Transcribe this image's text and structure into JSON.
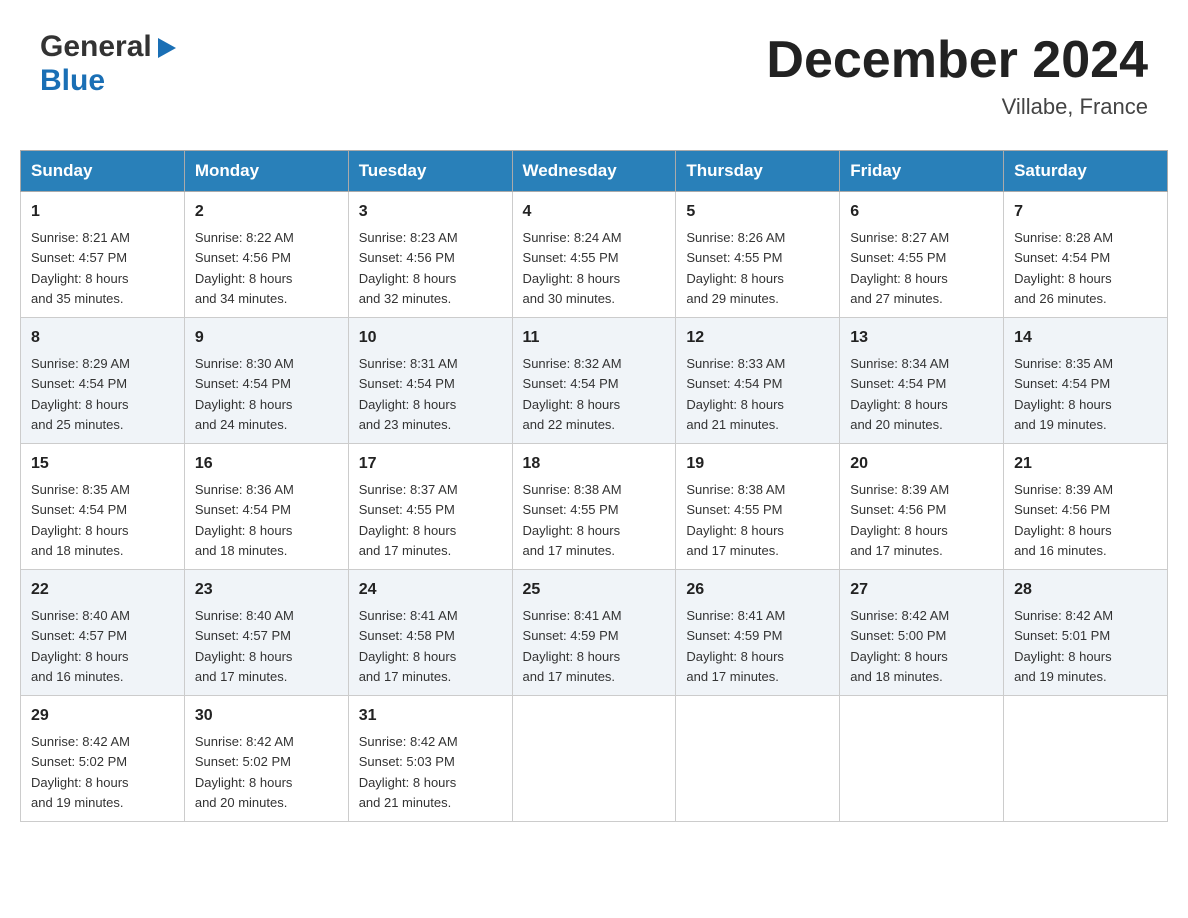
{
  "header": {
    "logo_line1": "General",
    "logo_line2": "Blue",
    "month_title": "December 2024",
    "location": "Villabe, France"
  },
  "calendar": {
    "days_of_week": [
      "Sunday",
      "Monday",
      "Tuesday",
      "Wednesday",
      "Thursday",
      "Friday",
      "Saturday"
    ],
    "weeks": [
      [
        {
          "day": "1",
          "sunrise": "Sunrise: 8:21 AM",
          "sunset": "Sunset: 4:57 PM",
          "daylight": "Daylight: 8 hours",
          "daylight2": "and 35 minutes."
        },
        {
          "day": "2",
          "sunrise": "Sunrise: 8:22 AM",
          "sunset": "Sunset: 4:56 PM",
          "daylight": "Daylight: 8 hours",
          "daylight2": "and 34 minutes."
        },
        {
          "day": "3",
          "sunrise": "Sunrise: 8:23 AM",
          "sunset": "Sunset: 4:56 PM",
          "daylight": "Daylight: 8 hours",
          "daylight2": "and 32 minutes."
        },
        {
          "day": "4",
          "sunrise": "Sunrise: 8:24 AM",
          "sunset": "Sunset: 4:55 PM",
          "daylight": "Daylight: 8 hours",
          "daylight2": "and 30 minutes."
        },
        {
          "day": "5",
          "sunrise": "Sunrise: 8:26 AM",
          "sunset": "Sunset: 4:55 PM",
          "daylight": "Daylight: 8 hours",
          "daylight2": "and 29 minutes."
        },
        {
          "day": "6",
          "sunrise": "Sunrise: 8:27 AM",
          "sunset": "Sunset: 4:55 PM",
          "daylight": "Daylight: 8 hours",
          "daylight2": "and 27 minutes."
        },
        {
          "day": "7",
          "sunrise": "Sunrise: 8:28 AM",
          "sunset": "Sunset: 4:54 PM",
          "daylight": "Daylight: 8 hours",
          "daylight2": "and 26 minutes."
        }
      ],
      [
        {
          "day": "8",
          "sunrise": "Sunrise: 8:29 AM",
          "sunset": "Sunset: 4:54 PM",
          "daylight": "Daylight: 8 hours",
          "daylight2": "and 25 minutes."
        },
        {
          "day": "9",
          "sunrise": "Sunrise: 8:30 AM",
          "sunset": "Sunset: 4:54 PM",
          "daylight": "Daylight: 8 hours",
          "daylight2": "and 24 minutes."
        },
        {
          "day": "10",
          "sunrise": "Sunrise: 8:31 AM",
          "sunset": "Sunset: 4:54 PM",
          "daylight": "Daylight: 8 hours",
          "daylight2": "and 23 minutes."
        },
        {
          "day": "11",
          "sunrise": "Sunrise: 8:32 AM",
          "sunset": "Sunset: 4:54 PM",
          "daylight": "Daylight: 8 hours",
          "daylight2": "and 22 minutes."
        },
        {
          "day": "12",
          "sunrise": "Sunrise: 8:33 AM",
          "sunset": "Sunset: 4:54 PM",
          "daylight": "Daylight: 8 hours",
          "daylight2": "and 21 minutes."
        },
        {
          "day": "13",
          "sunrise": "Sunrise: 8:34 AM",
          "sunset": "Sunset: 4:54 PM",
          "daylight": "Daylight: 8 hours",
          "daylight2": "and 20 minutes."
        },
        {
          "day": "14",
          "sunrise": "Sunrise: 8:35 AM",
          "sunset": "Sunset: 4:54 PM",
          "daylight": "Daylight: 8 hours",
          "daylight2": "and 19 minutes."
        }
      ],
      [
        {
          "day": "15",
          "sunrise": "Sunrise: 8:35 AM",
          "sunset": "Sunset: 4:54 PM",
          "daylight": "Daylight: 8 hours",
          "daylight2": "and 18 minutes."
        },
        {
          "day": "16",
          "sunrise": "Sunrise: 8:36 AM",
          "sunset": "Sunset: 4:54 PM",
          "daylight": "Daylight: 8 hours",
          "daylight2": "and 18 minutes."
        },
        {
          "day": "17",
          "sunrise": "Sunrise: 8:37 AM",
          "sunset": "Sunset: 4:55 PM",
          "daylight": "Daylight: 8 hours",
          "daylight2": "and 17 minutes."
        },
        {
          "day": "18",
          "sunrise": "Sunrise: 8:38 AM",
          "sunset": "Sunset: 4:55 PM",
          "daylight": "Daylight: 8 hours",
          "daylight2": "and 17 minutes."
        },
        {
          "day": "19",
          "sunrise": "Sunrise: 8:38 AM",
          "sunset": "Sunset: 4:55 PM",
          "daylight": "Daylight: 8 hours",
          "daylight2": "and 17 minutes."
        },
        {
          "day": "20",
          "sunrise": "Sunrise: 8:39 AM",
          "sunset": "Sunset: 4:56 PM",
          "daylight": "Daylight: 8 hours",
          "daylight2": "and 17 minutes."
        },
        {
          "day": "21",
          "sunrise": "Sunrise: 8:39 AM",
          "sunset": "Sunset: 4:56 PM",
          "daylight": "Daylight: 8 hours",
          "daylight2": "and 16 minutes."
        }
      ],
      [
        {
          "day": "22",
          "sunrise": "Sunrise: 8:40 AM",
          "sunset": "Sunset: 4:57 PM",
          "daylight": "Daylight: 8 hours",
          "daylight2": "and 16 minutes."
        },
        {
          "day": "23",
          "sunrise": "Sunrise: 8:40 AM",
          "sunset": "Sunset: 4:57 PM",
          "daylight": "Daylight: 8 hours",
          "daylight2": "and 17 minutes."
        },
        {
          "day": "24",
          "sunrise": "Sunrise: 8:41 AM",
          "sunset": "Sunset: 4:58 PM",
          "daylight": "Daylight: 8 hours",
          "daylight2": "and 17 minutes."
        },
        {
          "day": "25",
          "sunrise": "Sunrise: 8:41 AM",
          "sunset": "Sunset: 4:59 PM",
          "daylight": "Daylight: 8 hours",
          "daylight2": "and 17 minutes."
        },
        {
          "day": "26",
          "sunrise": "Sunrise: 8:41 AM",
          "sunset": "Sunset: 4:59 PM",
          "daylight": "Daylight: 8 hours",
          "daylight2": "and 17 minutes."
        },
        {
          "day": "27",
          "sunrise": "Sunrise: 8:42 AM",
          "sunset": "Sunset: 5:00 PM",
          "daylight": "Daylight: 8 hours",
          "daylight2": "and 18 minutes."
        },
        {
          "day": "28",
          "sunrise": "Sunrise: 8:42 AM",
          "sunset": "Sunset: 5:01 PM",
          "daylight": "Daylight: 8 hours",
          "daylight2": "and 19 minutes."
        }
      ],
      [
        {
          "day": "29",
          "sunrise": "Sunrise: 8:42 AM",
          "sunset": "Sunset: 5:02 PM",
          "daylight": "Daylight: 8 hours",
          "daylight2": "and 19 minutes."
        },
        {
          "day": "30",
          "sunrise": "Sunrise: 8:42 AM",
          "sunset": "Sunset: 5:02 PM",
          "daylight": "Daylight: 8 hours",
          "daylight2": "and 20 minutes."
        },
        {
          "day": "31",
          "sunrise": "Sunrise: 8:42 AM",
          "sunset": "Sunset: 5:03 PM",
          "daylight": "Daylight: 8 hours",
          "daylight2": "and 21 minutes."
        },
        null,
        null,
        null,
        null
      ]
    ]
  }
}
